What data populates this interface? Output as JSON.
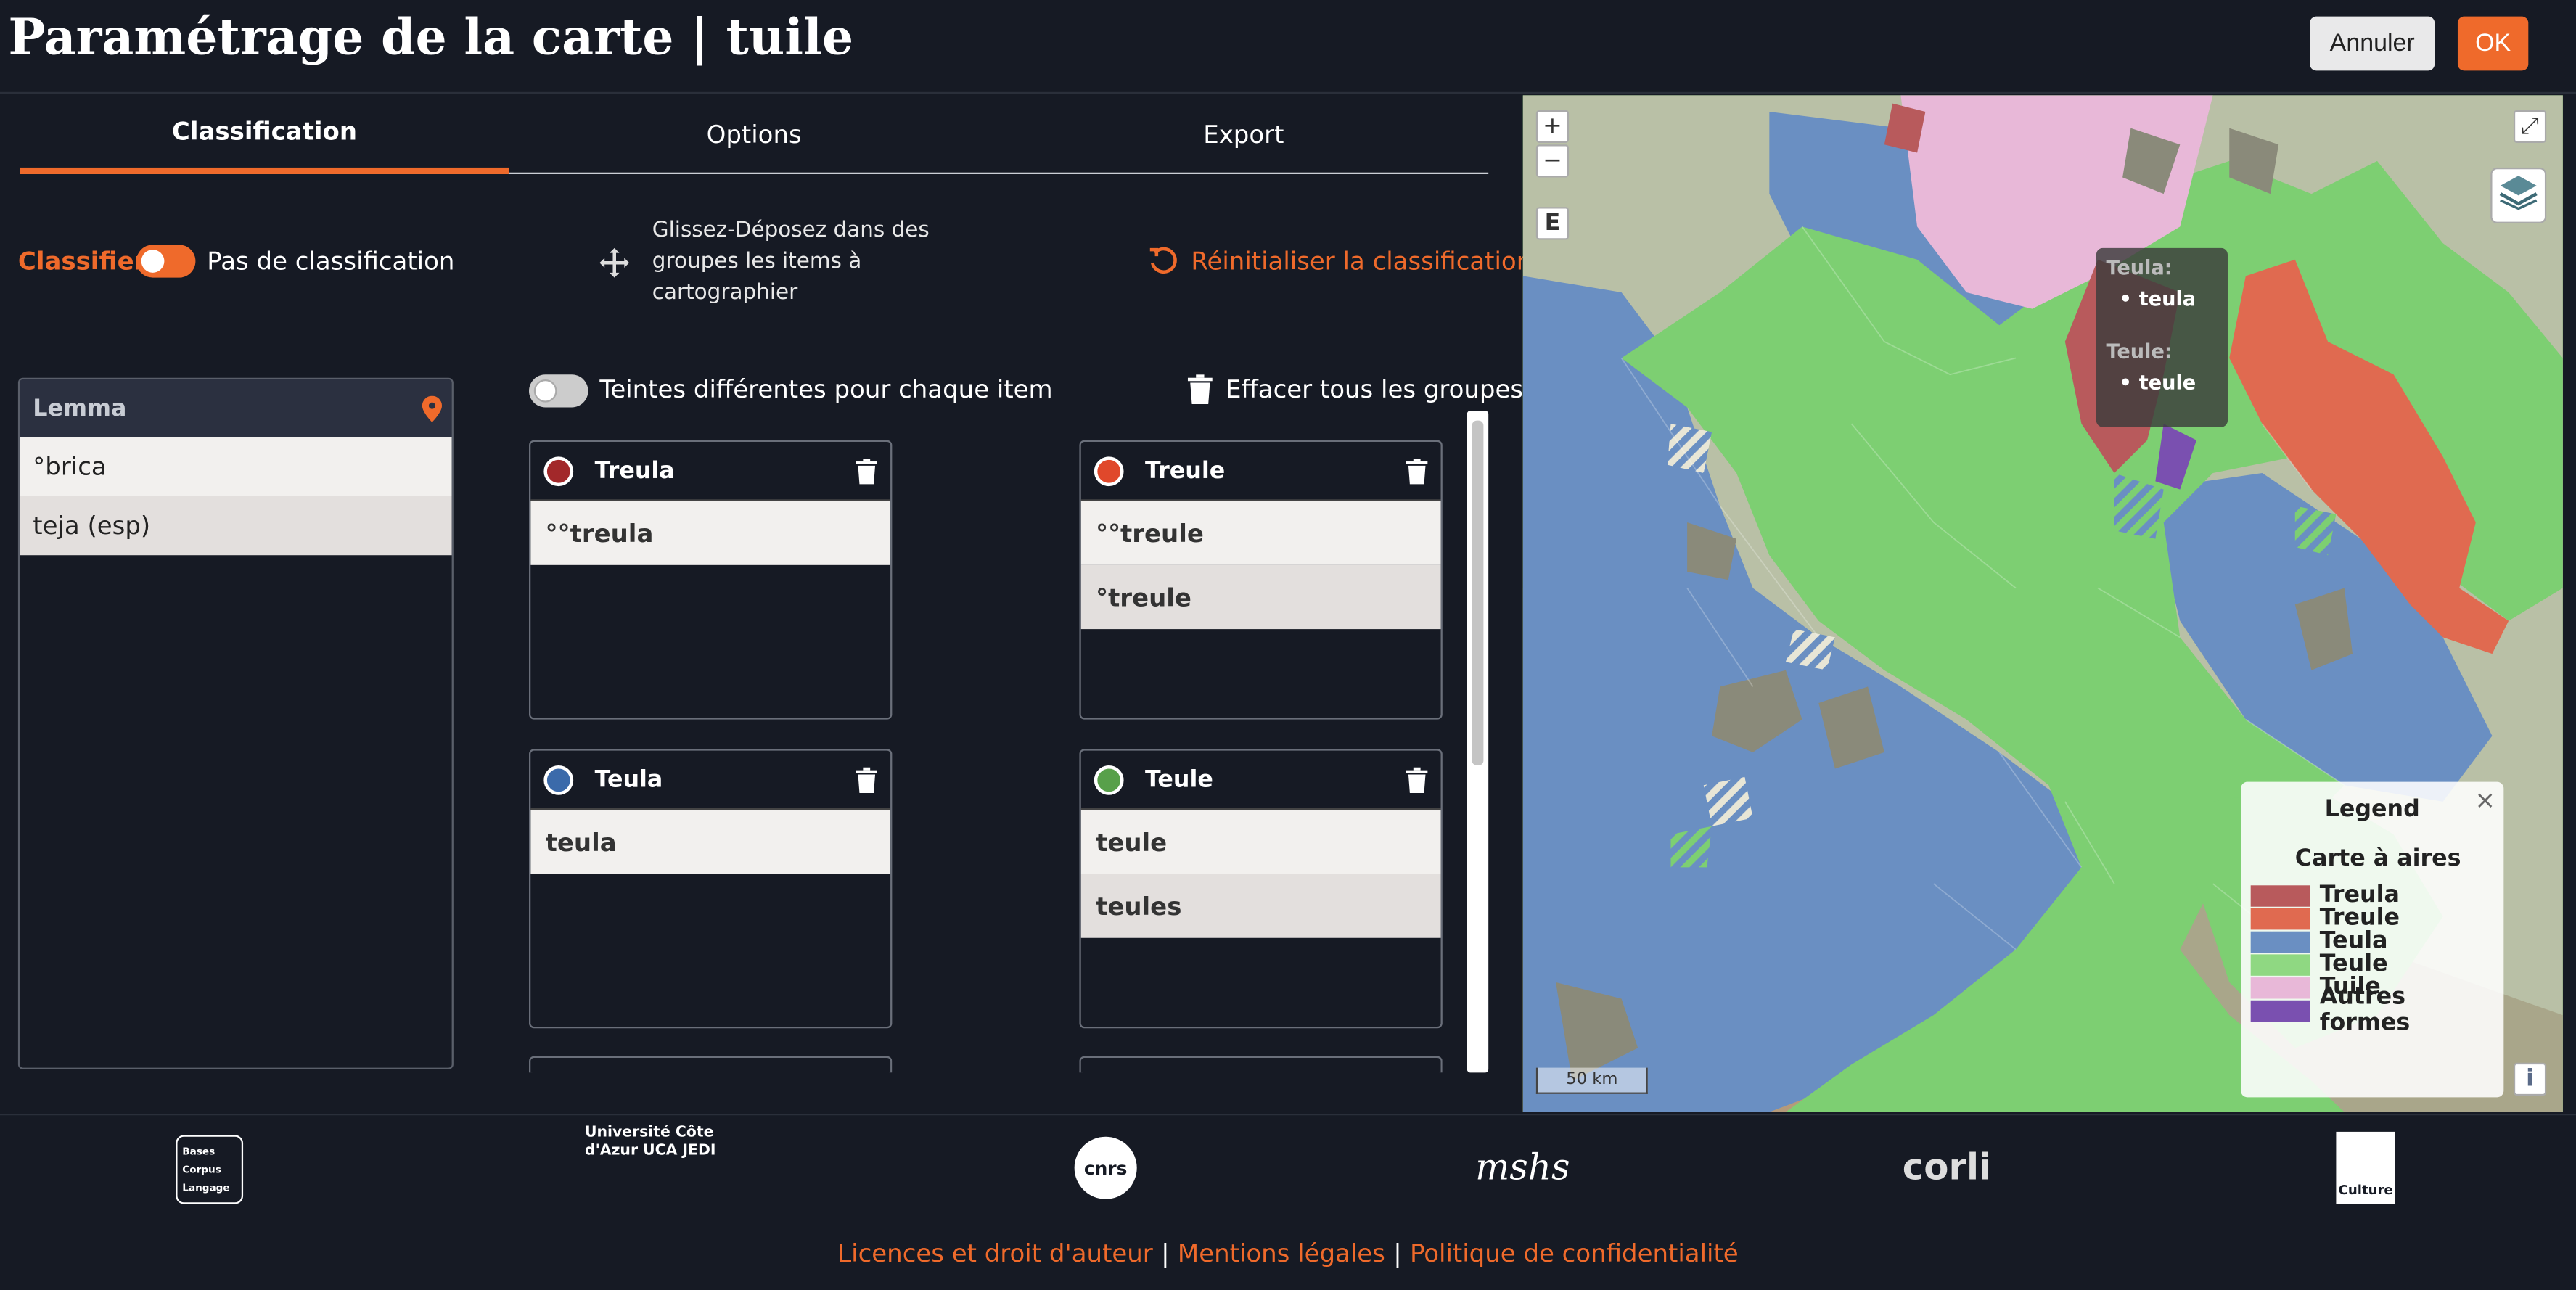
{
  "header": {
    "title": "Paramétrage de la carte | tuile",
    "cancel_label": "Annuler",
    "ok_label": "OK"
  },
  "tabs": [
    {
      "label": "Classification",
      "active": true
    },
    {
      "label": "Options",
      "active": false
    },
    {
      "label": "Export",
      "active": false
    }
  ],
  "classification": {
    "classifier_label": "Classifier",
    "classifier_state": "Pas de classification",
    "drag_hint": "Glissez-Déposez dans des groupes les items à cartographier",
    "reset_label": "Réinitialiser la classification",
    "tints_label": "Teintes différentes pour chaque item",
    "clear_groups_label": "Effacer tous les groupes"
  },
  "lemma": {
    "header": "Lemma",
    "items": [
      "°brica",
      "teja (esp)"
    ]
  },
  "groups": [
    {
      "name": "Treula",
      "color": "#a2282a",
      "items": [
        "°°treula"
      ]
    },
    {
      "name": "Treule",
      "color": "#e0482b",
      "items": [
        "°°treule",
        "°treule"
      ]
    },
    {
      "name": "Teula",
      "color": "#3b6aaa",
      "items": [
        "teula"
      ]
    },
    {
      "name": "Teule",
      "color": "#58a04a",
      "items": [
        "teule",
        "teules"
      ]
    }
  ],
  "map": {
    "zoom_in": "+",
    "zoom_out": "−",
    "edit": "E",
    "fullscreen": "⤢",
    "info": "i",
    "scale_label": "50 km",
    "tooltip": [
      {
        "group": "Teula:",
        "items": [
          "teula"
        ]
      },
      {
        "group": "Teule:",
        "items": [
          "teule"
        ]
      }
    ],
    "legend": {
      "title": "Legend",
      "subtitle": "Carte à aires",
      "close": "×",
      "entries": [
        {
          "label": "Treula",
          "color": "#b85a5c"
        },
        {
          "label": "Treule",
          "color": "#e06a50"
        },
        {
          "label": "Teula",
          "color": "#6a8fc2"
        },
        {
          "label": "Teule",
          "color": "#8fd882"
        },
        {
          "label": "Tuile",
          "color": "#e8b8d8"
        },
        {
          "label": "Autres formes",
          "color": "#7a50b0"
        }
      ]
    }
  },
  "footer": {
    "logos": [
      "Bases Corpus Langage",
      "Université Côte d'Azur UCA JEDI",
      "cnrs",
      "mshs",
      "corli",
      "Culture"
    ],
    "links": [
      "Licences et droit d'auteur",
      "Mentions légales",
      "Politique de confidentialité"
    ]
  }
}
